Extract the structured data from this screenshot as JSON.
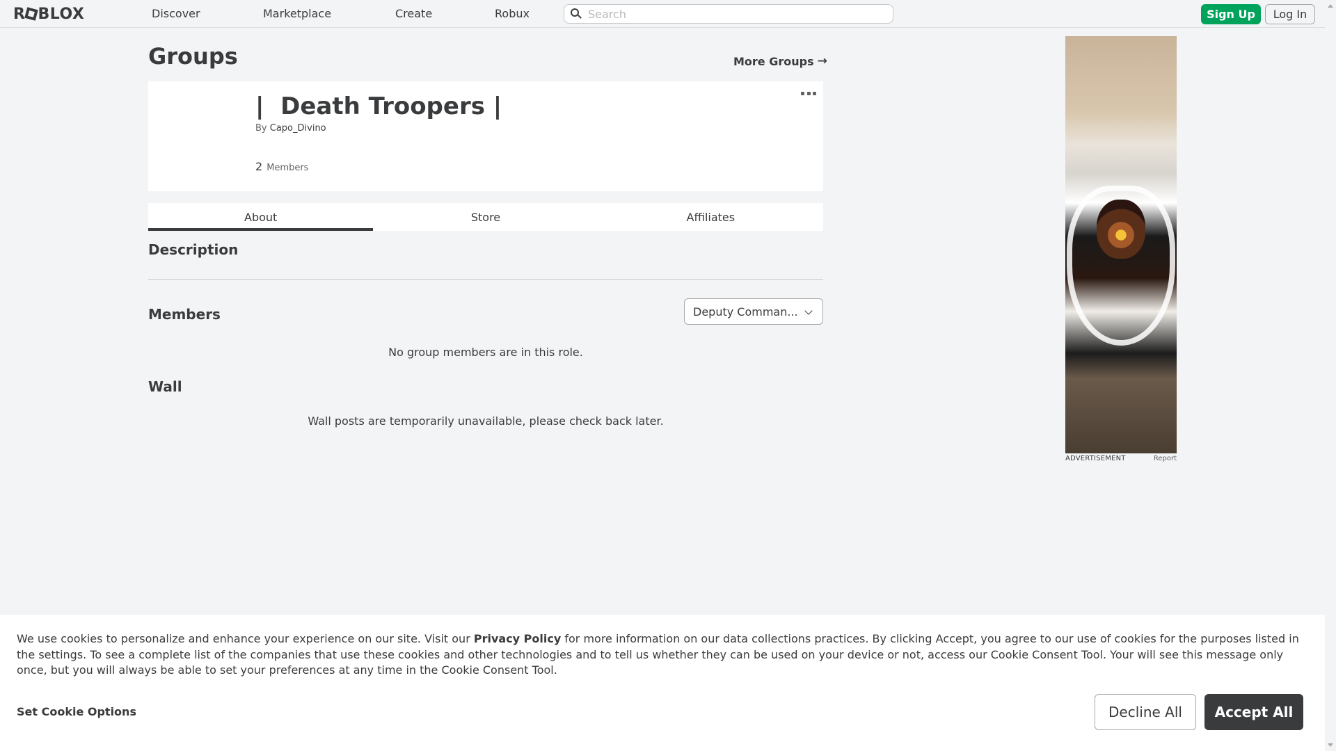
{
  "header": {
    "logo_text_a": "R",
    "logo_text_b": "BLOX",
    "nav": [
      "Discover",
      "Marketplace",
      "Create",
      "Robux"
    ],
    "search_placeholder": "Search",
    "signup_label": "Sign Up",
    "login_label": "Log In"
  },
  "page": {
    "title": "Groups",
    "more_groups_label": "More Groups",
    "more_groups_arrow": "→"
  },
  "group": {
    "name": "|  Death Troopers |",
    "by_label": "By",
    "owner": "Capo_Divino",
    "member_count": "2",
    "members_label": "Members"
  },
  "tabs": [
    {
      "label": "About",
      "active": true
    },
    {
      "label": "Store",
      "active": false
    },
    {
      "label": "Affiliates",
      "active": false
    }
  ],
  "about": {
    "description_title": "Description",
    "members_title": "Members",
    "role_selected": "Deputy Comman...",
    "members_empty": "No group members are in this role.",
    "wall_title": "Wall",
    "wall_empty": "Wall posts are temporarily unavailable, please check back later."
  },
  "ad": {
    "label": "ADVERTISEMENT",
    "report_label": "Report"
  },
  "cookie_banner": {
    "text_before": "We use cookies to personalize and enhance your experience on our site. Visit our ",
    "privacy_link": "Privacy Policy",
    "text_after": " for more information on our data collections practices. By clicking Accept, you agree to our use of cookies for the purposes listed in the settings. To see a complete list of the companies that use these cookies and other technologies and to tell us whether they can be used on your device or not, access our Cookie Consent Tool. Your will see this message only once, but you will always be able to set your preferences at any time in the Cookie Consent Tool.",
    "set_options_label": "Set Cookie Options",
    "decline_label": "Decline All",
    "accept_label": "Accept All"
  },
  "colors": {
    "background": "#f2f4f5",
    "primary_text": "#393b3d",
    "signup_green": "#00a35c",
    "accept_dark": "#393b3d"
  }
}
